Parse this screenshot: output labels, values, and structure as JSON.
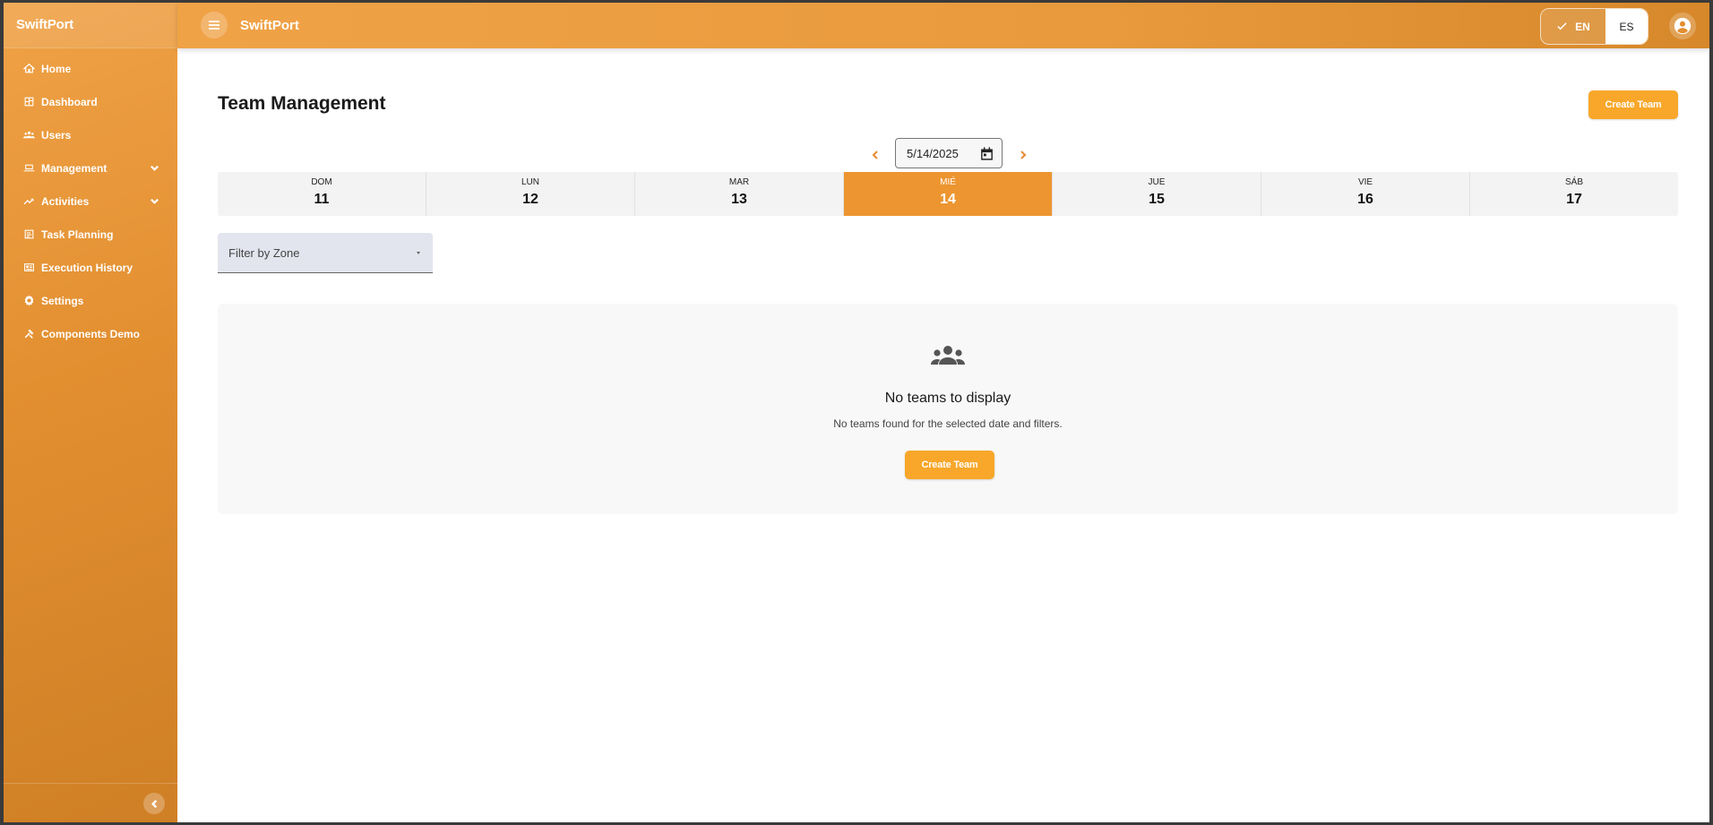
{
  "app": {
    "brand": "SwiftPort",
    "title": "SwiftPort"
  },
  "sidebar": {
    "items": [
      {
        "label": "Home",
        "icon": "home-icon"
      },
      {
        "label": "Dashboard",
        "icon": "dashboard-icon"
      },
      {
        "label": "Users",
        "icon": "users-icon"
      },
      {
        "label": "Management",
        "icon": "laptop-icon",
        "expandable": true
      },
      {
        "label": "Activities",
        "icon": "trending-icon",
        "expandable": true
      },
      {
        "label": "Task Planning",
        "icon": "task-icon"
      },
      {
        "label": "Execution History",
        "icon": "history-icon"
      },
      {
        "label": "Settings",
        "icon": "gear-icon"
      },
      {
        "label": "Components Demo",
        "icon": "tools-icon"
      }
    ]
  },
  "topbar": {
    "lang_en": "EN",
    "lang_es": "ES",
    "selected_lang": "EN"
  },
  "main": {
    "page_title": "Team Management",
    "create_team_label": "Create Team",
    "date_value": "5/14/2025",
    "week": [
      {
        "name": "DOM",
        "day": "11",
        "active": false
      },
      {
        "name": "LUN",
        "day": "12",
        "active": false
      },
      {
        "name": "MAR",
        "day": "13",
        "active": false
      },
      {
        "name": "MIÉ",
        "day": "14",
        "active": true
      },
      {
        "name": "JUE",
        "day": "15",
        "active": false
      },
      {
        "name": "VIE",
        "day": "16",
        "active": false
      },
      {
        "name": "SÁB",
        "day": "17",
        "active": false
      }
    ],
    "zone_filter_label": "Filter by Zone",
    "empty": {
      "title": "No teams to display",
      "subtitle": "No teams found for the selected date and filters.",
      "button_label": "Create Team"
    }
  },
  "colors": {
    "accent": "#ED9530",
    "button": "#F8A72A",
    "active_day": "#ED9530"
  }
}
